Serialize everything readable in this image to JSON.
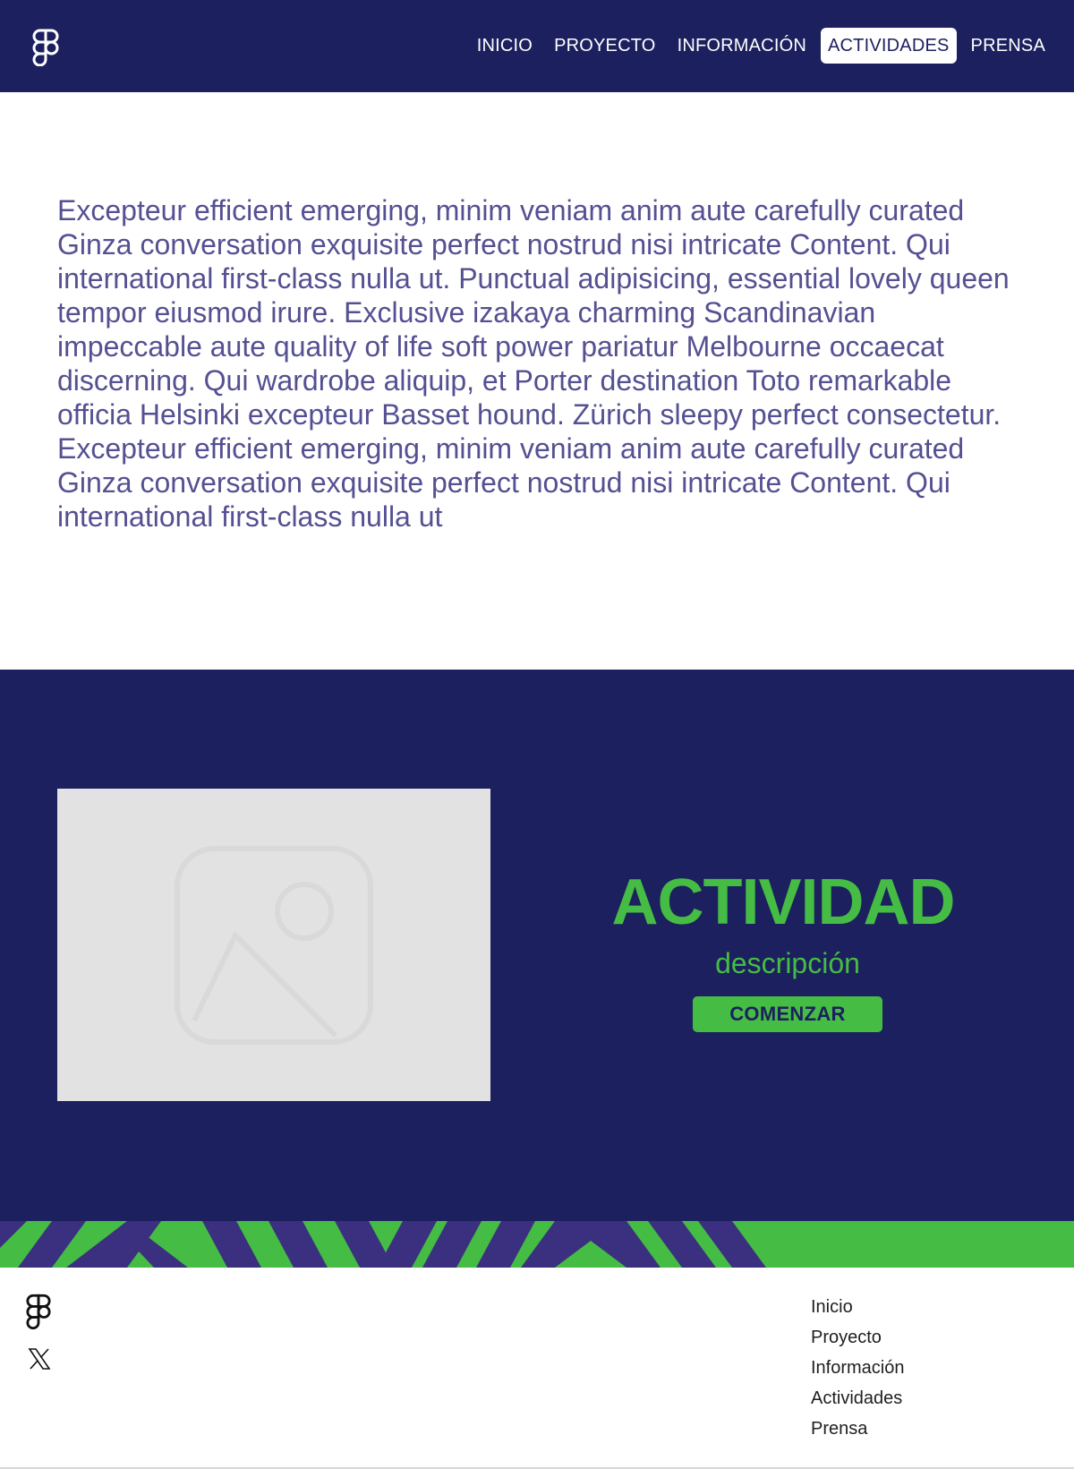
{
  "header": {
    "nav": [
      {
        "label": "INICIO"
      },
      {
        "label": "PROYECTO"
      },
      {
        "label": "INFORMACIÓN"
      },
      {
        "label": "ACTIVIDADES",
        "active": true
      },
      {
        "label": "PRENSA"
      }
    ]
  },
  "intro": {
    "paragraphs": [
      "Excepteur efficient emerging, minim veniam anim aute carefully curated Ginza conversation exquisite perfect nostrud nisi intricate Content. Qui  international first-class nulla ut. Punctual adipisicing, essential lovely queen tempor eiusmod irure. Exclusive izakaya charming Scandinavian impeccable aute quality of life soft power pariatur Melbourne occaecat discerning. Qui wardrobe aliquip, et Porter destination Toto remarkable officia Helsinki excepteur Basset hound. Zürich sleepy perfect consectetur.",
      "Excepteur efficient emerging, minim veniam anim aute carefully curated Ginza conversation exquisite perfect nostrud nisi intricate Content. Qui  international first-class nulla ut"
    ]
  },
  "activity": {
    "title": "ACTIVIDAD",
    "description": "descripción",
    "button_label": "COMENZAR",
    "image_icon": "image-placeholder-icon"
  },
  "footer": {
    "logo_icon": "figma-logo-icon",
    "social_icon": "x-icon",
    "links": [
      "Inicio",
      "Proyecto",
      "Información",
      "Actividades",
      "Prensa"
    ]
  },
  "colors": {
    "navy": "#1c205e",
    "green": "#45bc43",
    "purple_text": "#545092",
    "pattern_purple": "#3b2f80"
  }
}
